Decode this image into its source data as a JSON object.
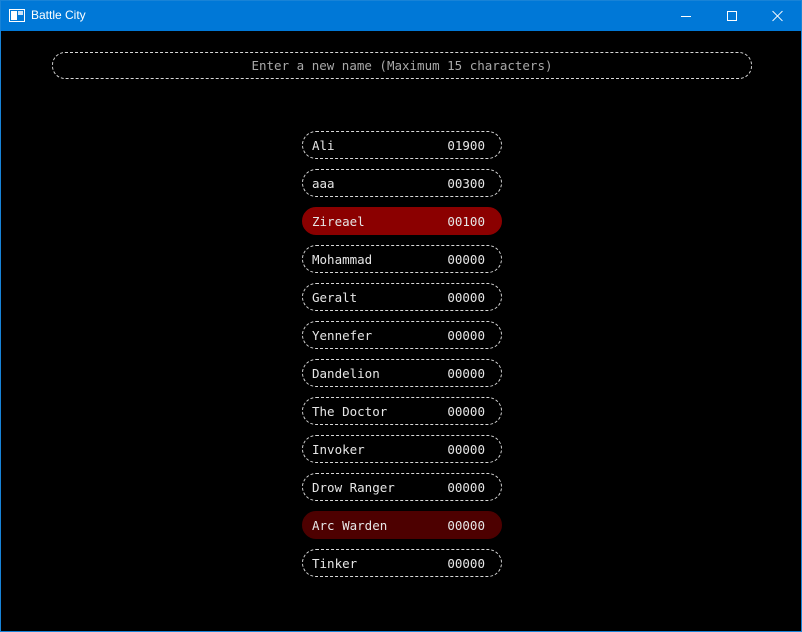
{
  "window": {
    "title": "Battle City",
    "accent_color": "#0078d7",
    "app_icon": "window-app-icon",
    "controls": [
      "minimize-icon",
      "maximize-icon",
      "close-icon"
    ]
  },
  "name_input": {
    "placeholder": "Enter a new name (Maximum 15 characters)",
    "value": ""
  },
  "leaderboard": {
    "selected_index": 2,
    "selected_color": "#8b0000",
    "hover_index": 10,
    "hover_color": "#4d0000",
    "entries": [
      {
        "name": "Ali",
        "score": "01900"
      },
      {
        "name": "aaa",
        "score": "00300"
      },
      {
        "name": "Zireael",
        "score": "00100"
      },
      {
        "name": "Mohammad",
        "score": "00000"
      },
      {
        "name": "Geralt",
        "score": "00000"
      },
      {
        "name": "Yennefer",
        "score": "00000"
      },
      {
        "name": "Dandelion",
        "score": "00000"
      },
      {
        "name": "The Doctor",
        "score": "00000"
      },
      {
        "name": "Invoker",
        "score": "00000"
      },
      {
        "name": "Drow Ranger",
        "score": "00000"
      },
      {
        "name": "Arc Warden",
        "score": "00000"
      },
      {
        "name": "Tinker",
        "score": "00000"
      }
    ]
  }
}
